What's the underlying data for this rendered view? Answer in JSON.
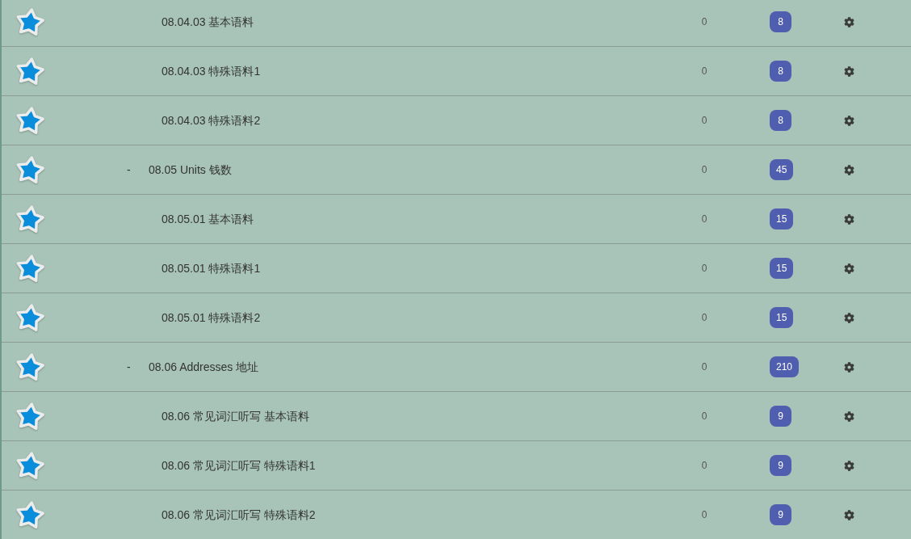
{
  "deck_tree": [
    {
      "children": [
        {
          "name": "08.04.03 基本语料",
          "number": "0",
          "badge": "8"
        },
        {
          "name": "08.04.03 特殊语料1",
          "number": "0",
          "badge": "8"
        },
        {
          "name": "08.04.03 特殊语料2",
          "number": "0",
          "badge": "8"
        }
      ]
    },
    {
      "toggle": "-",
      "name": "08.05 Units 钱数",
      "number": "0",
      "badge": "45",
      "children": [
        {
          "name": "08.05.01 基本语料",
          "number": "0",
          "badge": "15"
        },
        {
          "name": "08.05.01 特殊语料1",
          "number": "0",
          "badge": "15"
        },
        {
          "name": "08.05.01 特殊语料2",
          "number": "0",
          "badge": "15"
        }
      ]
    },
    {
      "toggle": "-",
      "name": "08.06 Addresses 地址",
      "number": "0",
      "badge": "210",
      "children": [
        {
          "name": "08.06 常见词汇听写 基本语料",
          "number": "0",
          "badge": "9"
        },
        {
          "name": "08.06 常见词汇听写 特殊语料1",
          "number": "0",
          "badge": "9"
        },
        {
          "name": "08.06 常见词汇听写 特殊语料2",
          "number": "0",
          "badge": "9"
        }
      ]
    }
  ]
}
